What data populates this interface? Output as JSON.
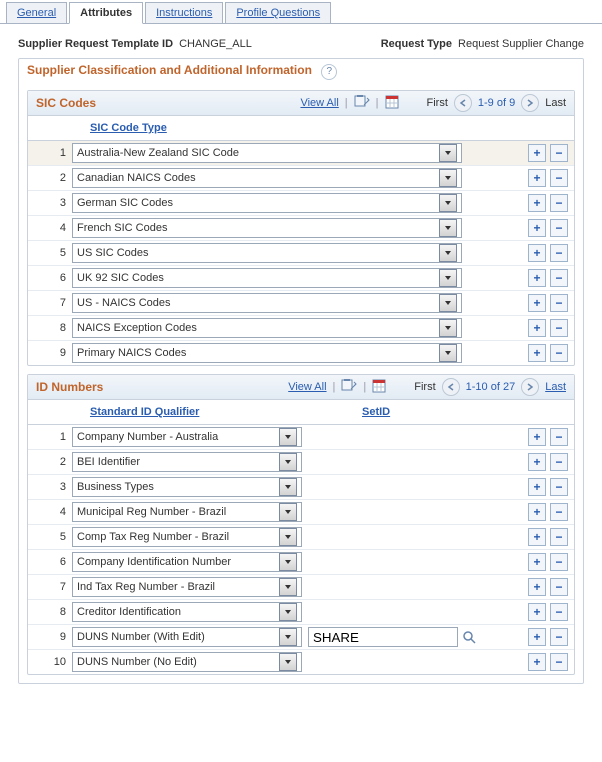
{
  "tabs": [
    {
      "label": "General",
      "active": false
    },
    {
      "label": "Attributes",
      "active": true
    },
    {
      "label": "Instructions",
      "active": false
    },
    {
      "label": "Profile Questions",
      "active": false
    }
  ],
  "header": {
    "template_id_label": "Supplier Request Template ID",
    "template_id_value": "CHANGE_ALL",
    "request_type_label": "Request Type",
    "request_type_value": "Request Supplier Change"
  },
  "section": {
    "title": "Supplier Classification and Additional Information"
  },
  "grid_common": {
    "view_all": "View All",
    "first": "First",
    "last": "Last"
  },
  "sic": {
    "title": "SIC Codes",
    "col": "SIC Code Type",
    "counter": "1-9 of 9",
    "last_link": false,
    "rows": [
      {
        "n": 1,
        "v": "Australia-New Zealand SIC Code",
        "sel": true
      },
      {
        "n": 2,
        "v": "Canadian NAICS Codes"
      },
      {
        "n": 3,
        "v": "German SIC Codes"
      },
      {
        "n": 4,
        "v": "French SIC Codes"
      },
      {
        "n": 5,
        "v": "US SIC Codes"
      },
      {
        "n": 6,
        "v": "UK 92 SIC Codes"
      },
      {
        "n": 7,
        "v": "US - NAICS Codes"
      },
      {
        "n": 8,
        "v": "NAICS Exception Codes"
      },
      {
        "n": 9,
        "v": "Primary NAICS Codes"
      }
    ]
  },
  "idn": {
    "title": "ID Numbers",
    "col_q": "Standard ID Qualifier",
    "col_s": "SetID",
    "counter": "1-10 of 27",
    "last_link": true,
    "rows": [
      {
        "n": 1,
        "v": "Company Number - Australia"
      },
      {
        "n": 2,
        "v": "BEI Identifier"
      },
      {
        "n": 3,
        "v": "Business Types"
      },
      {
        "n": 4,
        "v": "Municipal Reg Number - Brazil"
      },
      {
        "n": 5,
        "v": "Comp Tax Reg Number - Brazil"
      },
      {
        "n": 6,
        "v": "Company Identification Number"
      },
      {
        "n": 7,
        "v": "Ind Tax Reg Number - Brazil"
      },
      {
        "n": 8,
        "v": "Creditor Identification"
      },
      {
        "n": 9,
        "v": "DUNS Number (With Edit)",
        "setid": "SHARE"
      },
      {
        "n": 10,
        "v": "DUNS Number (No Edit)"
      }
    ]
  }
}
